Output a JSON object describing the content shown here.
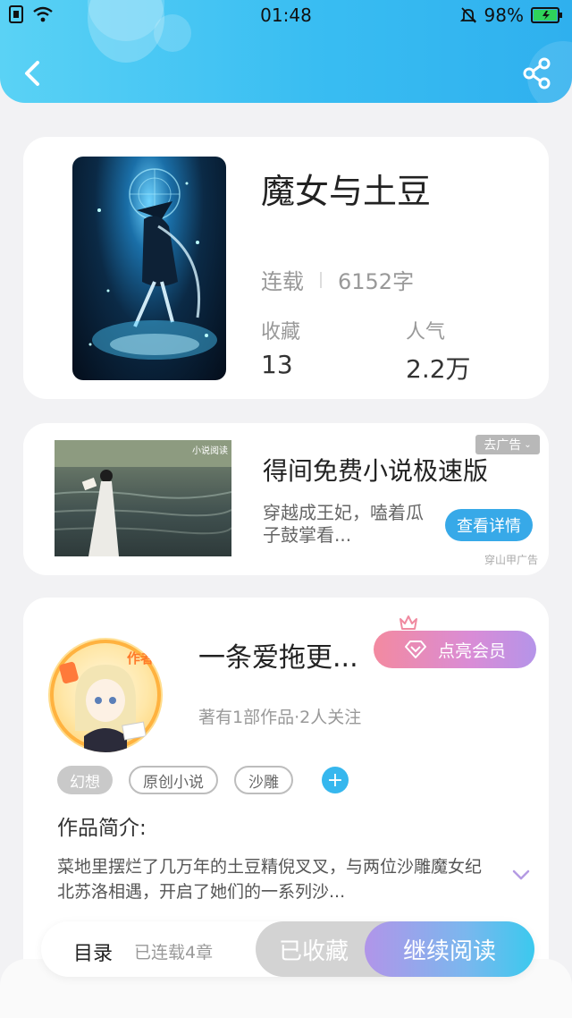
{
  "status_bar": {
    "time": "01:48",
    "battery": "98%"
  },
  "header": {
    "back_icon": "chevron-left-icon",
    "share_icon": "share-icon"
  },
  "book": {
    "title": "魔女与土豆",
    "status": "连载",
    "word_count": "6152字",
    "favorites_label": "收藏",
    "favorites_value": "13",
    "popularity_label": "人气",
    "popularity_value": "2.2万"
  },
  "ad": {
    "title": "得间免费小说极速版",
    "description": "穿越成王妃，嗑着瓜子鼓掌看...",
    "close_label": "去广告",
    "button_label": "查看详情",
    "source": "穿山甲广告",
    "image_caption": "小说阅读"
  },
  "author": {
    "name": "一条爱拖更...",
    "badge_text": "作者",
    "vip_label": "点亮会员",
    "subtitle": "著有1部作品·2人关注",
    "tags": [
      "幻想",
      "原创小说",
      "沙雕"
    ],
    "add_tag_symbol": "+",
    "intro_title": "作品简介:",
    "intro_text": "菜地里摆烂了几万年的土豆精倪叉叉，与两位沙雕魔女纪北苏洛相遇，开启了她们的一系列沙..."
  },
  "bottom_bar": {
    "toc_label": "目录",
    "toc_count": "已连载4章",
    "favorite_label": "已收藏",
    "read_label": "继续阅读"
  },
  "colors": {
    "accent": "#39bdf2",
    "ad_button": "#37a9e8",
    "vip_start": "#f38aa0",
    "vip_end": "#b594e9"
  }
}
